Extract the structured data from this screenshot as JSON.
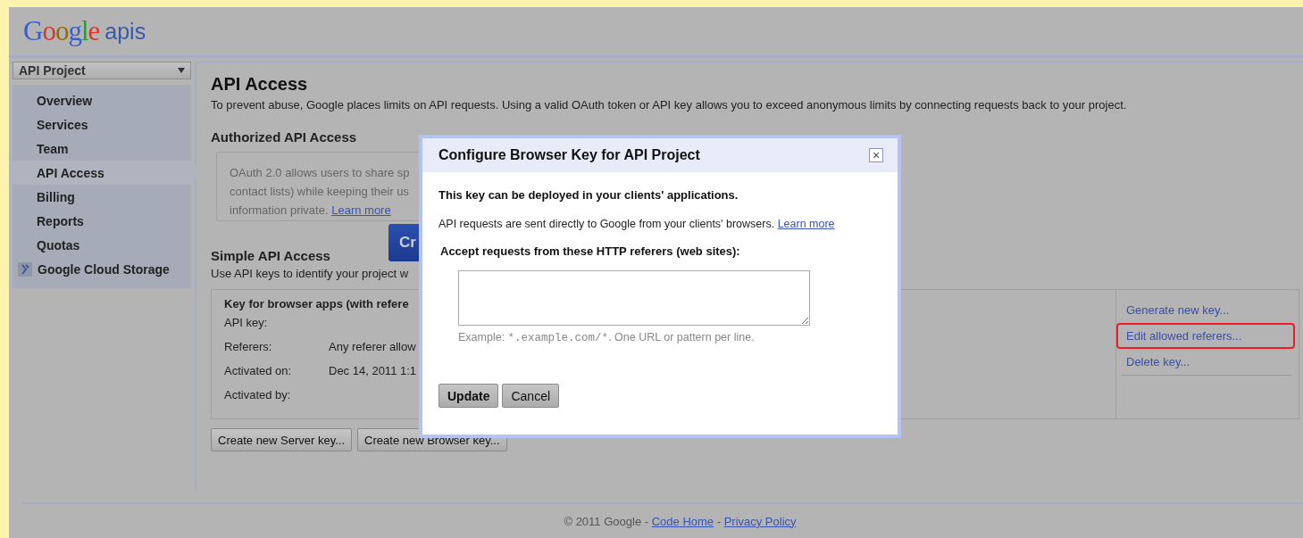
{
  "logo": {
    "brand": "Google",
    "product": "apis"
  },
  "project_select": {
    "value": "API Project"
  },
  "sidebar": {
    "items": [
      {
        "label": "Overview",
        "selected": false
      },
      {
        "label": "Services",
        "selected": false
      },
      {
        "label": "Team",
        "selected": false
      },
      {
        "label": "API Access",
        "selected": true
      },
      {
        "label": "Billing",
        "selected": false
      },
      {
        "label": "Reports",
        "selected": false
      },
      {
        "label": "Quotas",
        "selected": false
      },
      {
        "label": "Google Cloud Storage",
        "selected": false,
        "kind": "icon"
      }
    ]
  },
  "main": {
    "title": "API Access",
    "intro": "To prevent abuse, Google places limits on API requests. Using a valid OAuth token or API key allows you to exceed anonymous limits by connecting requests back to your project.",
    "authorized": {
      "heading": "Authorized API Access",
      "lines": [
        "OAuth 2.0 allows users to share sp",
        "contact lists) while keeping their us"
      ],
      "last_line": "information private.",
      "link": "Learn more",
      "button": "Cr"
    },
    "simple": {
      "heading": "Simple API Access",
      "description": "Use API keys to identify your project w",
      "key": {
        "title": "Key for browser apps (with refere",
        "fields": [
          {
            "label": "API key:"
          },
          {
            "label": "Referers:",
            "value": "Any referer allow"
          },
          {
            "label": "Activated on:",
            "value": "Dec 14, 2011 1:1"
          },
          {
            "label": "Activated by:"
          }
        ],
        "actions": [
          {
            "label": "Generate new key...",
            "highlighted": false
          },
          {
            "label": "Edit allowed referers...",
            "highlighted": true
          },
          {
            "label": "Delete key...",
            "highlighted": false
          }
        ]
      },
      "buttons": [
        "Create new Server key...",
        "Create new Browser key..."
      ]
    }
  },
  "footer": {
    "copyright": "© 2011 Google - ",
    "links": [
      "Code Home",
      "Privacy Policy"
    ],
    "separator": " - "
  },
  "dialog": {
    "title": "Configure Browser Key for API Project",
    "close": "×",
    "lead": "This key can be deployed in your clients' applications.",
    "info": "API requests are sent directly to Google from your clients' browsers.",
    "info_link": "Learn more",
    "field_label": "Accept requests from these HTTP referers (web sites):",
    "example": {
      "prefix": "Example: ",
      "code": "*.example.com/*",
      "suffix": ". One URL or pattern per line."
    },
    "buttons": [
      {
        "label": "Update",
        "primary": true
      },
      {
        "label": "Cancel",
        "primary": false
      }
    ]
  }
}
